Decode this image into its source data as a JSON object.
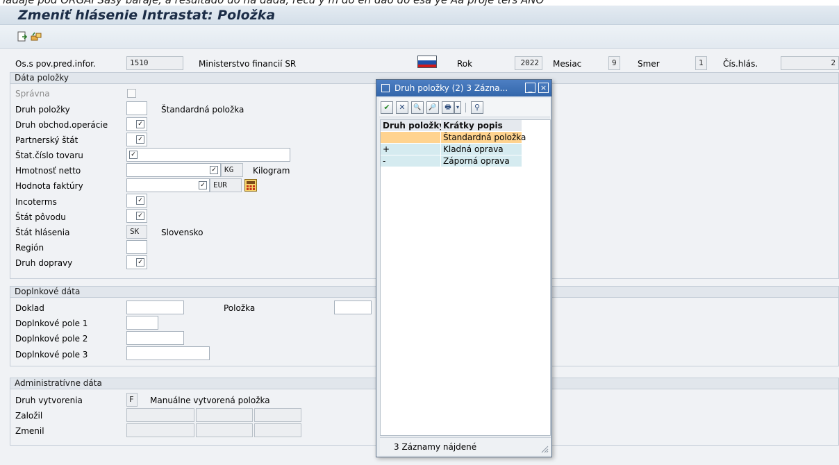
{
  "window": {
    "cropped_top_text": "ladaje pod ORGAI Sasý baraje, a resultado do na dada, recu y m do en dao do esa ye Aa proje ters ANO",
    "title": "Zmeniť hlásenie Intrastat: Položka"
  },
  "toolbar": {
    "icons": [
      "save-doc-icon",
      "transport-icon"
    ]
  },
  "header": {
    "reporter_label": "Os.s pov.pred.infor.",
    "reporter_value": "1510",
    "reporter_name": "Ministerstvo financií SR",
    "flag": "slovakia-flag-icon",
    "year_label": "Rok",
    "year_value": "2022",
    "month_label": "Mesiac",
    "month_value": "9",
    "direction_label": "Smer",
    "direction_value": "1",
    "report_no_label": "Čís.hlás.",
    "report_no_value": "2"
  },
  "item_group": {
    "title": "Dáta položky",
    "correct_label": "Správna",
    "item_type_label": "Druh položky",
    "item_type_value": "",
    "item_type_text": "Štandardná položka",
    "transaction_label": "Druh obchod.operácie",
    "partner_label": "Partnerský štát",
    "commodity_label": "Štat.číslo tovaru",
    "net_weight_label": "Hmotnosť netto",
    "net_weight_unit": "KG",
    "net_weight_unit_text": "Kilogram",
    "invoice_label": "Hodnota faktúry",
    "invoice_currency": "EUR",
    "incoterms_label": "Incoterms",
    "origin_label": "Štát pôvodu",
    "report_country_label": "Štát hlásenia",
    "report_country_value": "SK",
    "report_country_text": "Slovensko",
    "region_label": "Región",
    "transport_label": "Druh dopravy",
    "check_mark": "✓"
  },
  "additional_group": {
    "title": "Doplnkové dáta",
    "doc_label": "Doklad",
    "item_label": "Položka",
    "extra1_label": "Doplnkové pole 1",
    "extra2_label": "Doplnkové pole 2",
    "extra3_label": "Doplnkové pole 3"
  },
  "admin_group": {
    "title": "Administratívne dáta",
    "creation_label": "Druh vytvorenia",
    "creation_value": "F",
    "creation_text": "Manuálne vytvorená položka",
    "created_by_label": "Založil",
    "changed_by_label": "Zmenil"
  },
  "popup": {
    "title": "Druh položky (2)   3 Zázna...",
    "minimize": "_",
    "close": "×",
    "tools": [
      "✔",
      "✕",
      "🔍",
      "🔎",
      "🖶",
      "▾",
      "⚲"
    ],
    "col1": "Druh položky",
    "col2": "Krátky popis",
    "rows": [
      {
        "code": "",
        "desc": "Štandardná položka"
      },
      {
        "code": "+",
        "desc": "Kladná oprava"
      },
      {
        "code": "-",
        "desc": "Záporná oprava"
      }
    ],
    "status": "3 Záznamy nájdené"
  },
  "colors": {
    "selected_row": "#ffd38f",
    "list_row": "#d5ebf0",
    "popup_title": "#3366aa"
  }
}
